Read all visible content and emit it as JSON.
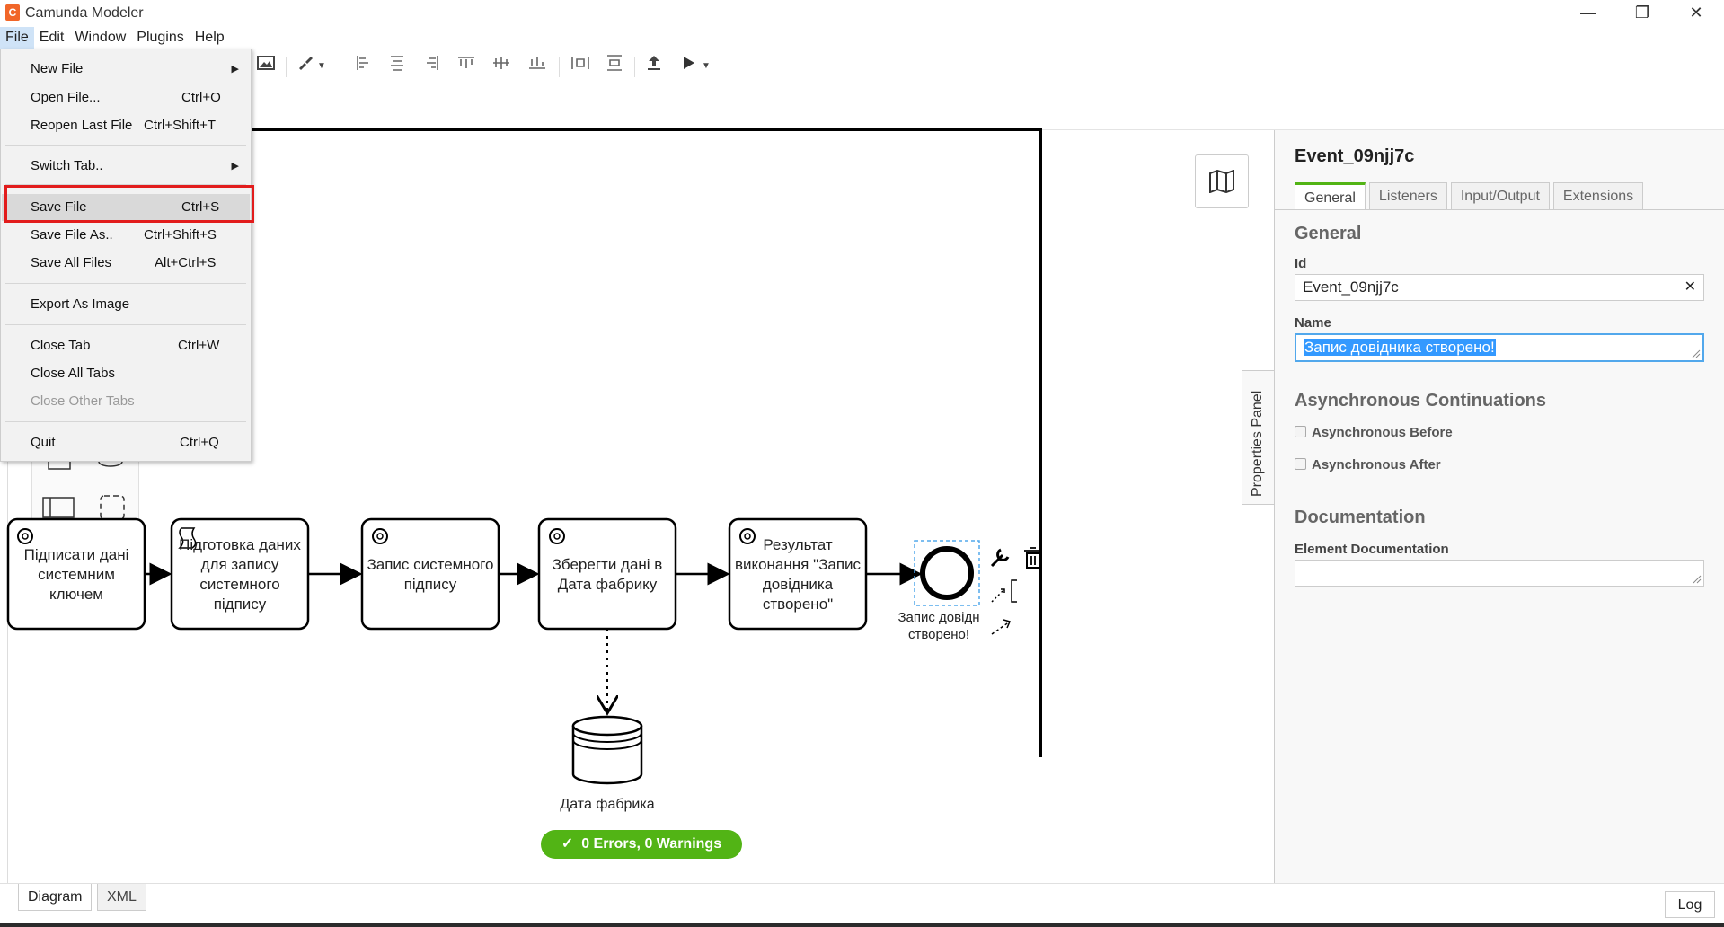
{
  "window": {
    "title": "Camunda Modeler",
    "minimize": "—",
    "restore": "❐",
    "close": "✕"
  },
  "menubar": {
    "items": [
      "File",
      "Edit",
      "Window",
      "Plugins",
      "Help"
    ]
  },
  "file_menu": {
    "items": [
      {
        "label": "New File",
        "accel": "",
        "submenu": true,
        "disabled": false
      },
      {
        "label": "Open File...",
        "accel": "Ctrl+O",
        "submenu": false,
        "disabled": false
      },
      {
        "label": "Reopen Last File",
        "accel": "Ctrl+Shift+T",
        "submenu": false,
        "disabled": false
      },
      {
        "label": "Switch Tab..",
        "accel": "",
        "submenu": true,
        "disabled": false
      },
      {
        "label": "Save File",
        "accel": "Ctrl+S",
        "submenu": false,
        "disabled": false,
        "highlighted": true
      },
      {
        "label": "Save File As..",
        "accel": "Ctrl+Shift+S",
        "submenu": false,
        "disabled": false
      },
      {
        "label": "Save All Files",
        "accel": "Alt+Ctrl+S",
        "submenu": false,
        "disabled": false
      },
      {
        "label": "Export As Image",
        "accel": "",
        "submenu": false,
        "disabled": false
      },
      {
        "label": "Close Tab",
        "accel": "Ctrl+W",
        "submenu": false,
        "disabled": false
      },
      {
        "label": "Close All Tabs",
        "accel": "",
        "submenu": false,
        "disabled": false
      },
      {
        "label": "Close Other Tabs",
        "accel": "",
        "submenu": false,
        "disabled": true
      },
      {
        "label": "Quit",
        "accel": "Ctrl+Q",
        "submenu": false,
        "disabled": false
      }
    ],
    "submenu_arrow": "▶"
  },
  "diagram": {
    "tasks": [
      "Підписати дані системним ключем",
      "Підготовка даних для запису системного підпису",
      "Запис системного підпису",
      "Зберегти дані в Дата фабрику",
      "Результат виконання \"Запис довідника створено\""
    ],
    "end_event_label": "Запис довідника створено!",
    "end_event_label_visible": [
      "Запис довідн",
      "створено!"
    ],
    "datastore_label": "Дата фабрика",
    "lint": "0 Errors, 0 Warnings",
    "lint_icon": "✓"
  },
  "bottom_tabs": {
    "diagram": "Diagram",
    "xml": "XML",
    "log": "Log"
  },
  "properties": {
    "toggle_label": "Properties Panel",
    "element_title": "Event_09njj7c",
    "tabs": [
      "General",
      "Listeners",
      "Input/Output",
      "Extensions"
    ],
    "active_tab": "General",
    "general_title": "General",
    "id_label": "Id",
    "id_value": "Event_09njj7c",
    "clear_icon": "✕",
    "name_label": "Name",
    "name_value": "Запис довідника створено!",
    "async_title": "Asynchronous Continuations",
    "async_before": "Asynchronous Before",
    "async_after": "Asynchronous After",
    "doc_title": "Documentation",
    "doc_label": "Element Documentation",
    "doc_value": ""
  },
  "colors": {
    "accent": "#52b415",
    "highlight_box": "#e21c1c",
    "selection": "#3399ff"
  }
}
